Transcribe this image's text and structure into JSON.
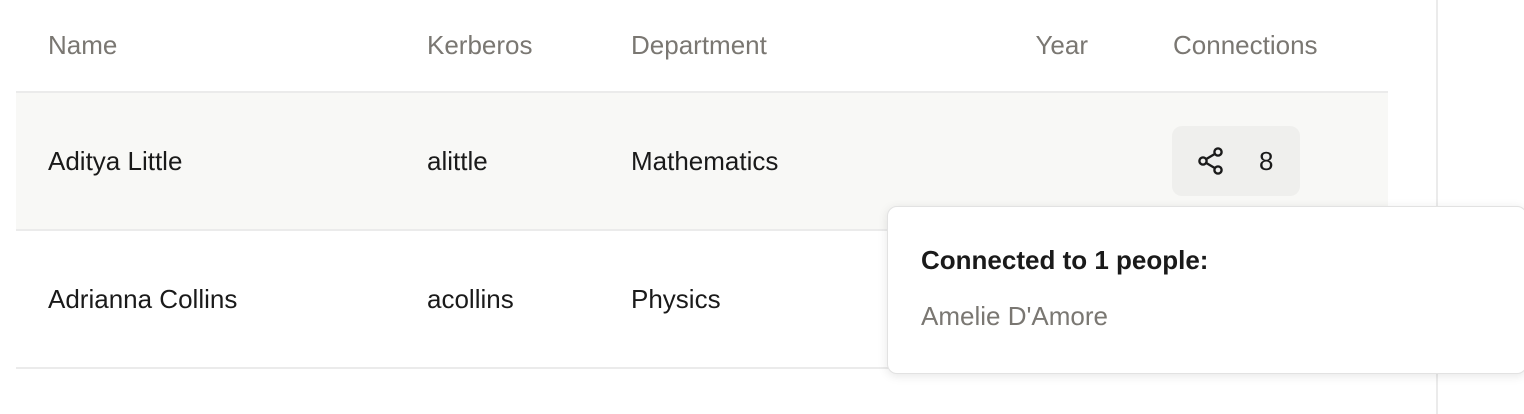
{
  "table": {
    "headers": {
      "name": "Name",
      "kerberos": "Kerberos",
      "department": "Department",
      "year": "Year",
      "connections": "Connections"
    },
    "rows": [
      {
        "name": "Aditya Little",
        "kerberos": "alittle",
        "department": "Mathematics",
        "year": "",
        "connections": "8"
      },
      {
        "name": "Adrianna Collins",
        "kerberos": "acollins",
        "department": "Physics",
        "year": "",
        "connections": ""
      }
    ]
  },
  "popover": {
    "title": "Connected to 1 people:",
    "items": [
      "Amelie D'Amore"
    ]
  },
  "icons": {
    "connections": "share-icon"
  },
  "colors": {
    "row_hover": "#f8f8f6",
    "button_bg": "#efefed",
    "muted_text": "#7a7772",
    "divider": "#ebebeb"
  }
}
